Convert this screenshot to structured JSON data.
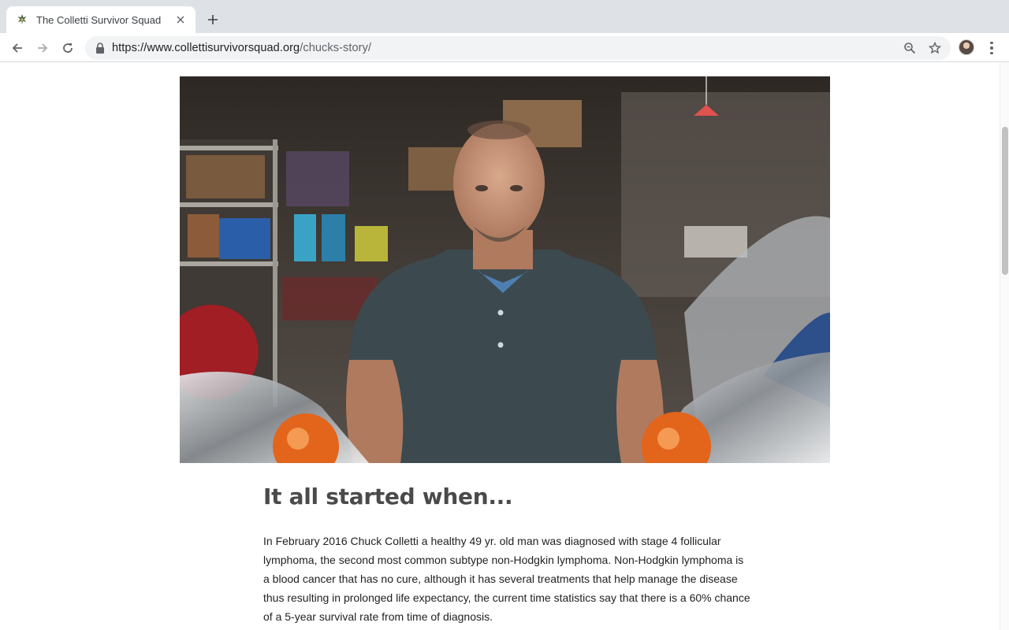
{
  "browser": {
    "tab_title": "The Colletti Survivor Squad",
    "url_host": "https://www.collettisurvivorsquad.org",
    "url_path": "/chucks-story/",
    "icons": {
      "favicon": "squad-logo-icon",
      "close": "close-icon",
      "new_tab": "plus-icon",
      "back": "arrow-left-icon",
      "forward": "arrow-right-icon",
      "reload": "reload-icon",
      "lock": "lock-icon",
      "zoom": "zoom-icon",
      "bookmark": "star-icon",
      "profile": "avatar",
      "menu": "kebab-menu-icon"
    }
  },
  "article": {
    "heading": "It all started when...",
    "paragraph": "In February 2016 Chuck Colletti a healthy 49 yr. old man was diagnosed with stage 4 follicular lymphoma, the second most common subtype non-Hodgkin lymphoma.  Non-Hodgkin lymphoma is a blood cancer that has no cure, although it has several treatments that help manage the disease thus resulting in prolonged life expectancy, the current time statistics say that there is a 60% chance of a 5-year survival rate from time of diagnosis."
  },
  "colors": {
    "tabstrip": "#dee1e6",
    "omnibox": "#f1f3f4",
    "heading": "#4a4a4a",
    "text": "#222222"
  }
}
